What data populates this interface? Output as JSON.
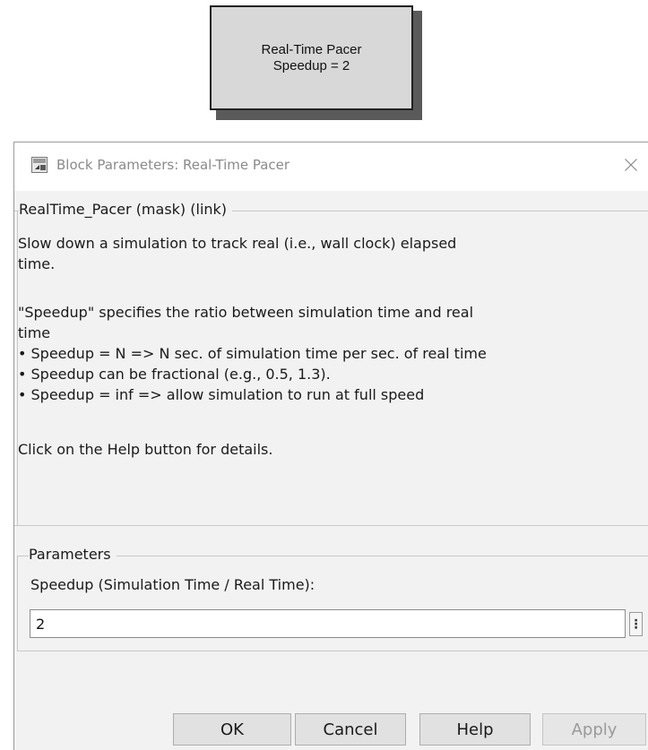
{
  "block": {
    "line1": "Real-Time Pacer",
    "line2": "Speedup = 2"
  },
  "dialog": {
    "title": "Block Parameters: Real-Time Pacer",
    "mask_group_label": "RealTime_Pacer (mask) (link)",
    "description": [
      "Slow down a simulation to track real (i.e., wall clock) elapsed",
      "time.",
      "",
      "\"Speedup\" specifies the ratio between simulation time and real",
      "time",
      "• Speedup = N => N sec. of simulation time per sec. of real time",
      "• Speedup can be fractional (e.g., 0.5, 1.3).",
      "• Speedup = inf => allow simulation to run at full speed",
      "",
      "Click on the Help button for details."
    ],
    "parameters_group_label": "Parameters",
    "speedup_label": "Speedup (Simulation Time / Real Time):",
    "speedup_value": "2",
    "more_options_glyph": "⋮",
    "buttons": {
      "ok": "OK",
      "cancel": "Cancel",
      "help": "Help",
      "apply": "Apply"
    }
  },
  "icons": {
    "title_icon": "simulink-block-icon",
    "close_icon": "close-icon"
  }
}
